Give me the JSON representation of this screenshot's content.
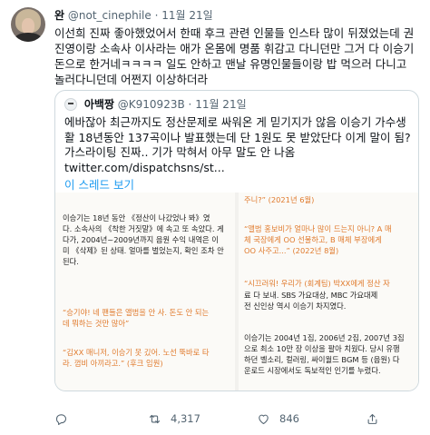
{
  "author": {
    "name": "완",
    "handle": "@not_cinephile",
    "separator": "·",
    "date": "11월 21일"
  },
  "tweet_lines": [
    "이선희 진짜 좋아했었어서 한때 후크 관련 인물들 인스타 많이 뒤졌었는데 권",
    "진영이랑 소속사 이사라는 애가 온몸에 명품 휘감고 다니던만 그거 다 이승기",
    "돈으로 한거네ㅋㅋㅋㅋ 일도 안하고 맨날 유명인물들이랑 밥 먹으러 다니고",
    "놀러다니던데 어쩐지 이상하더라"
  ],
  "quote": {
    "name": "아백짱",
    "handle": "@K910923B",
    "separator": "·",
    "date": "11월 21일",
    "lines": [
      "에바잖아 최근까지도 정산문제로 싸워온 게 믿기지가 않음 이승기 가수생",
      "활 18년동안 137곡이나 발표했는데 단 1원도 못 받았단다 이게 말이 됨?",
      "가스라이팅 진짜.. 기가 막혀서 아무 말도 안 나옴",
      "twitter.com/dispatchsns/st..."
    ],
    "thread_link": "이 스레드 보기"
  },
  "article_left": [
    "이승기는 18년 동안 《정산이 나갔었나 봐》였",
    "다. 소속사의 《착한 거짓말》에 속고 또 속았다. 게",
    "다가, 2004년~2009년까지 음원 수익 내역은 이",
    "미 《삭제》된 상태. 얼마를 벌었는지, 확인 조차 안",
    "된다."
  ],
  "article_left_quote1": [
    "“승기야! 네 팬들은 앨범을 안 사. 돈도 안 되는",
    "데 뭐하는 것만 많아”"
  ],
  "article_left_quote2": [
    "“김XX 매니저, 이승기 못 깄어. 노선 뚝바로 타",
    "라. 껌비 아끼라고.” (후크 임원)"
  ],
  "article_right_top": [
    "주니?” (2021년 6월)"
  ],
  "article_right_quote1": [
    "“앨범 홍보비가 얼마나 많이 드는지 아니? A 매",
    "체 국장에게 OO 선물하고, B 매체 부장에게",
    "OO 사주고...” (2022년 8월)"
  ],
  "article_right_quote2": [
    "“시끄러워! 우리가 (회계팀) 박XX에게 정산 자"
  ],
  "article_right_body1": [
    "료 다 보내. SBS 가요대상, MBC 가요대제",
    "전 신인상 역시 이승기 차지였다."
  ],
  "article_right_body2": [
    "이승기는 2004년 1집, 2006년 2집, 2007년 3집",
    "으로 최소 10만 장 이상을 팔아 치웠다. 당시 유행",
    "하던 벨소리, 컬러링, 싸이월드 BGM 등 (음원) 다",
    "운로드 시장에서도 독보적인 인기를 누렸다."
  ],
  "actions": {
    "reply_count": "",
    "retweet_count": "4,317",
    "like_count": "846"
  },
  "colors": {
    "link": "#1d9bf0",
    "muted": "#536471",
    "article_accent": "#e07a2c"
  }
}
